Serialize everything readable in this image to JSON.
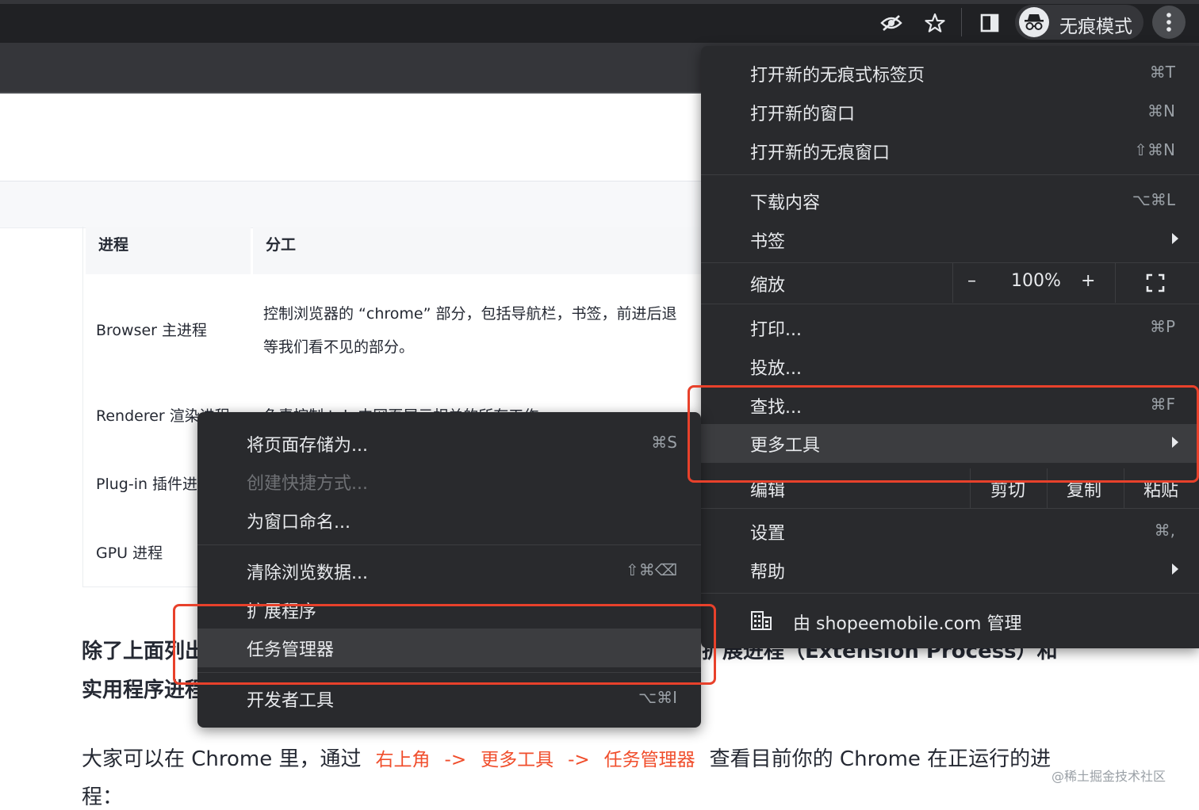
{
  "toolbar": {
    "incognito_label": "无痕模式",
    "icons": [
      "eye-off-icon",
      "star-icon",
      "sidepanel-icon",
      "incognito-icon",
      "kebab-menu-icon"
    ]
  },
  "table": {
    "headers": [
      "进程",
      "分工"
    ],
    "rows": [
      {
        "process": "Browser 主进程",
        "duty_line1": "控制浏览器的 “chrome” 部分，包括导航栏，书签，前进后退",
        "duty_line2": "等我们看不见的部分。"
      },
      {
        "process": "Renderer 渲染进程",
        "duty_line1": "负责控制 tab 内网页展示相关的所有工作"
      },
      {
        "process": "Plug-in 插件进程"
      },
      {
        "process": "GPU 进程"
      }
    ]
  },
  "paragraphs": {
    "p1_line1_start": "除了上面列出",
    "p1_line1_end": "扩展进程（Extension Process）和",
    "p1_line2_start": "实用程序进程",
    "p2_a": "大家可以在 Chrome 里，通过",
    "p2_link1": "右上角",
    "p2_arrow1": "->",
    "p2_link2": "更多工具",
    "p2_arrow2": "->",
    "p2_link3": "任务管理器",
    "p2_b": "查看目前你的 Chrome 在正运行的进",
    "p2_line2": "程："
  },
  "main_menu": {
    "new_incognito_tab": {
      "label": "打开新的无痕式标签页",
      "shortcut": "⌘T"
    },
    "new_window": {
      "label": "打开新的窗口",
      "shortcut": "⌘N"
    },
    "new_incognito_window": {
      "label": "打开新的无痕窗口",
      "shortcut": "⇧⌘N"
    },
    "downloads": {
      "label": "下载内容",
      "shortcut": "⌥⌘L"
    },
    "bookmarks": {
      "label": "书签"
    },
    "zoom": {
      "label": "缩放",
      "minus": "–",
      "value": "100%",
      "plus": "+"
    },
    "print": {
      "label": "打印...",
      "shortcut": "⌘P"
    },
    "cast": {
      "label": "投放..."
    },
    "find": {
      "label": "查找...",
      "shortcut": "⌘F"
    },
    "more_tools": {
      "label": "更多工具"
    },
    "edit": {
      "label": "编辑",
      "cut": "剪切",
      "copy": "复制",
      "paste": "粘贴"
    },
    "settings": {
      "label": "设置",
      "shortcut": "⌘,"
    },
    "help": {
      "label": "帮助"
    },
    "managed": {
      "label": "由 shopeemobile.com 管理"
    }
  },
  "sub_menu": {
    "save_page": {
      "label": "将页面存储为...",
      "shortcut": "⌘S"
    },
    "create_shortcut": {
      "label": "创建快捷方式..."
    },
    "name_window": {
      "label": "为窗口命名..."
    },
    "clear_data": {
      "label": "清除浏览数据...",
      "shortcut": "⇧⌘⌫"
    },
    "extensions": {
      "label": "扩展程序"
    },
    "task_manager": {
      "label": "任务管理器"
    },
    "dev_tools": {
      "label": "开发者工具",
      "shortcut": "⌥⌘I"
    }
  },
  "watermark": "@稀土掘金技术社区",
  "colors": {
    "menu_bg": "#292a2d",
    "menu_highlight": "#3c3d40",
    "annotation_red": "#e8412b",
    "link_red": "#f04e2c"
  }
}
